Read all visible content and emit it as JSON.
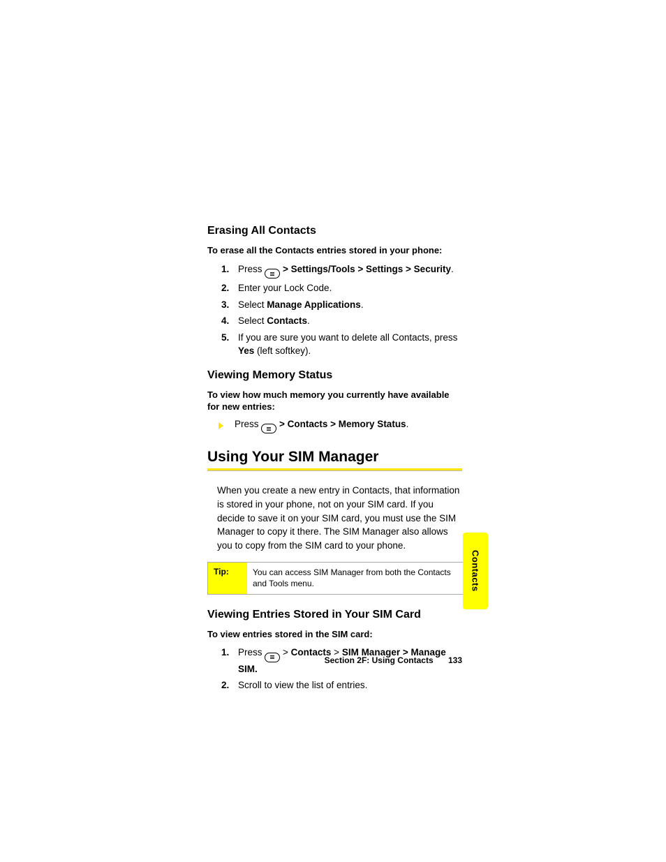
{
  "section1": {
    "heading": "Erasing All Contacts",
    "intro": "To erase all the Contacts entries stored in your phone:",
    "steps": [
      {
        "pre": "Press ",
        "kbd": true,
        "post": " > Settings/Tools > Settings > Security",
        "post_bold": true,
        "tail": "."
      },
      {
        "text": "Enter your Lock Code."
      },
      {
        "pre": "Select ",
        "bold": "Manage Applications",
        "tail": "."
      },
      {
        "pre": "Select ",
        "bold": "Contacts",
        "tail": "."
      },
      {
        "pre": "If you are sure you want to delete all Contacts, press ",
        "bold": "Yes",
        "tail": " (left softkey)."
      }
    ]
  },
  "section2": {
    "heading": "Viewing Memory Status",
    "intro": "To view how much memory you currently have available for new entries:",
    "bullet": {
      "pre": "Press ",
      "kbd": true,
      "post": " > Contacts > Memory Status",
      "post_bold": true,
      "tail": "."
    }
  },
  "h1": "Using Your SIM Manager",
  "para": "When you create a new entry in Contacts, that information is stored in your phone, not on your SIM card. If you decide to save it on your SIM card, you must use the SIM Manager to copy it there. The SIM Manager also allows you to copy from the SIM card to your phone.",
  "tip": {
    "label": "Tip:",
    "text": "You can access SIM Manager from both the Contacts and Tools menu."
  },
  "section3": {
    "heading": "Viewing Entries Stored in Your SIM Card",
    "intro": "To view entries stored in the SIM card:",
    "steps": [
      {
        "pre": "Press ",
        "kbd": true,
        "mid": "  >  ",
        "bold1": "Contacts",
        "mid2": "  >  ",
        "bold2": "SIM Manager > Manage SIM."
      },
      {
        "text": "Scroll to view the list of entries."
      }
    ]
  },
  "footer": {
    "section": "Section 2F: Using Contacts",
    "page": "133"
  },
  "sidetab": "Contacts"
}
